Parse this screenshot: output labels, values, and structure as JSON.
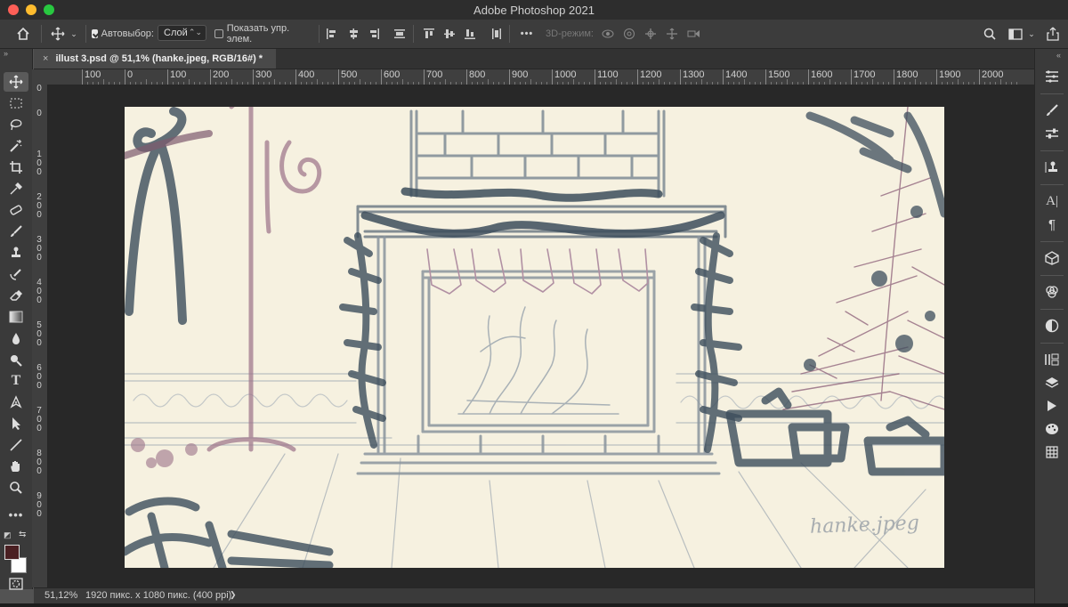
{
  "window": {
    "title": "Adobe Photoshop 2021"
  },
  "options": {
    "auto_select_label": "Автовыбор:",
    "auto_select_checked": true,
    "layer_select_value": "Слой",
    "show_controls_label": "Показать упр. элем.",
    "show_controls_checked": false,
    "mode_3d_label": "3D-режим:",
    "more_label": "•••"
  },
  "document": {
    "tab_title": "illust 3.psd @ 51,1% (hanke.jpeg, RGB/16#) *",
    "tab_close": "×"
  },
  "ruler": {
    "h_labels": [
      "100",
      "0",
      "100",
      "200",
      "300",
      "400",
      "500",
      "600",
      "700",
      "800",
      "900",
      "1000",
      "1100",
      "1200",
      "1300",
      "1400",
      "1500",
      "1600",
      "1700",
      "1800",
      "1900",
      "2000"
    ],
    "v_labels": [
      "0",
      "0",
      "1 0 0",
      "2 0 0",
      "3 0 0",
      "4 0 0",
      "5 0 0",
      "6 0 0",
      "7 0 0",
      "8 0 0",
      "9 0 0"
    ]
  },
  "canvas": {
    "watermark": "hanke.jpeg"
  },
  "status": {
    "zoom": "51,12%",
    "doc_info": "1920 пикс. x 1080 пикс. (400 ppi)",
    "arrow": "❯"
  },
  "colors": {
    "foreground": "#4a1f22",
    "background": "#ffffff",
    "sketch_slate": "#3d4e5c",
    "sketch_mauve": "#8c5f78"
  }
}
